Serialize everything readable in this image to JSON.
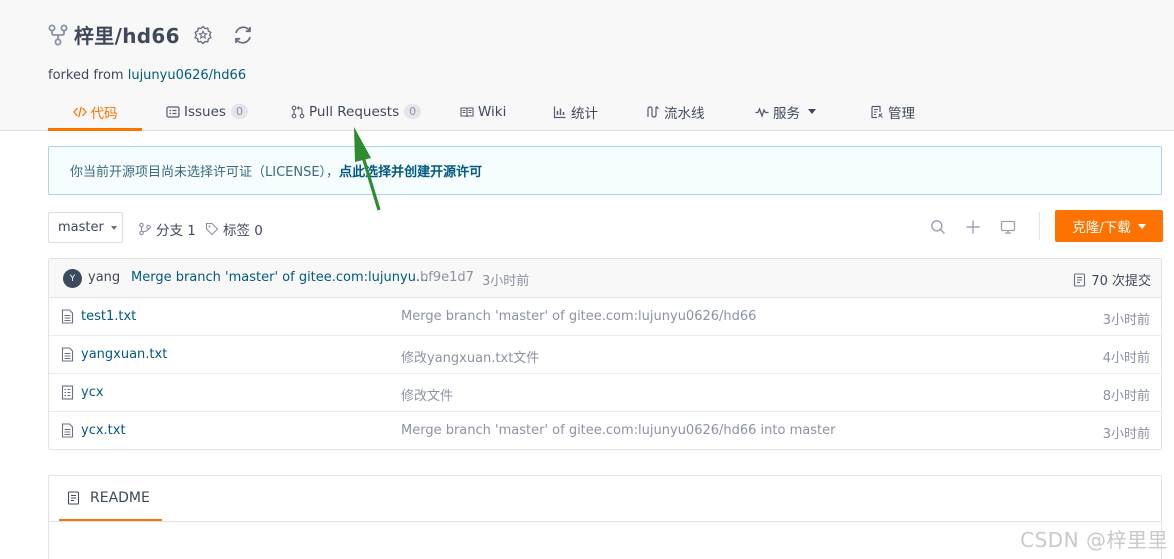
{
  "repo": {
    "name": "梓里/hd66",
    "forked_prefix": "forked from ",
    "forked_link": "lujunyu0626/hd66"
  },
  "tabs": [
    {
      "label": "代码",
      "icon": "code-icon",
      "active": true
    },
    {
      "label": "Issues",
      "badge": "0",
      "icon": "issues-icon"
    },
    {
      "label": "Pull Requests",
      "badge": "0",
      "icon": "pull-request-icon"
    },
    {
      "label": "Wiki",
      "icon": "wiki-icon"
    },
    {
      "label": "统计",
      "icon": "stats-icon"
    },
    {
      "label": "流水线",
      "icon": "pipeline-icon"
    },
    {
      "label": "服务",
      "icon": "service-icon"
    },
    {
      "label": "管理",
      "icon": "manage-icon"
    }
  ],
  "license_notice": {
    "text": "你当前开源项目尚未选择许可证（LICENSE），",
    "link": "点此选择并创建开源许可"
  },
  "toolbar": {
    "branch": "master",
    "branches_label": "分支 1",
    "tags_label": "标签 0",
    "clone_label": "克隆/下载"
  },
  "latest_commit": {
    "avatar_letter": "Y",
    "author": "yang",
    "message": "Merge branch 'master' of gitee.com:lujunyu...",
    "sha": "bf9e1d7",
    "time": "3小时前",
    "count": "70 次提交"
  },
  "files": [
    {
      "name": "test1.txt",
      "message": "Merge branch 'master' of gitee.com:lujunyu0626/hd66",
      "time": "3小时前",
      "icon": "text-file-icon"
    },
    {
      "name": "yangxuan.txt",
      "message": "修改yangxuan.txt文件",
      "time": "4小时前",
      "icon": "text-file-icon"
    },
    {
      "name": "ycx",
      "message": "修改文件",
      "time": "8小时前",
      "icon": "binary-file-icon"
    },
    {
      "name": "ycx.txt",
      "message": "Merge branch 'master' of gitee.com:lujunyu0626/hd66 into master",
      "time": "3小时前",
      "icon": "text-file-icon"
    }
  ],
  "readme": {
    "label": "README"
  },
  "watermark": "CSDN @梓里里",
  "colors": {
    "accent": "#fe7300",
    "link": "#005980",
    "annotation_arrow": "#2e8b2e"
  }
}
